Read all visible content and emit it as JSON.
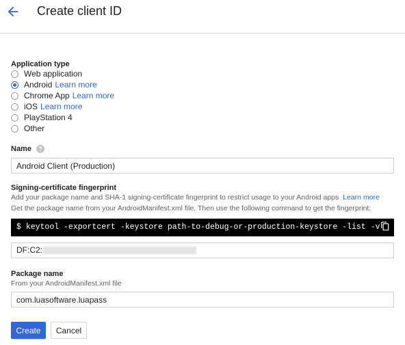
{
  "header": {
    "title": "Create client ID",
    "back_icon": "arrow-back-icon"
  },
  "app_type": {
    "label": "Application type",
    "options": [
      {
        "label": "Web application",
        "link": "",
        "checked": false
      },
      {
        "label": "Android",
        "link": "Learn more",
        "checked": true
      },
      {
        "label": "Chrome App",
        "link": "Learn more",
        "checked": false
      },
      {
        "label": "iOS",
        "link": "Learn more",
        "checked": false
      },
      {
        "label": "PlayStation 4",
        "link": "",
        "checked": false
      },
      {
        "label": "Other",
        "link": "",
        "checked": false
      }
    ]
  },
  "name": {
    "label": "Name",
    "help_icon": "help-icon",
    "value": "Android Client (Production)"
  },
  "fingerprint": {
    "label": "Signing-certificate fingerprint",
    "desc1": "Add your package name and SHA-1 signing-certificate fingerprint to restrict usage to your Android apps",
    "desc1_link": "Learn more",
    "desc2": "Get the package name from your AndroidManifest.xml file. Then use the following command to get the fingerprint:",
    "command_prompt": "$",
    "command": "keytool -exportcert -keystore path-to-debug-or-production-keystore -list -v",
    "copy_icon": "copy-icon",
    "value_prefix": "DF:C2:"
  },
  "package": {
    "label": "Package name",
    "desc": "From your AndroidManifest.xml file",
    "value": "com.luasoftware.luapass"
  },
  "buttons": {
    "create": "Create",
    "cancel": "Cancel"
  },
  "colors": {
    "accent": "#3367d6",
    "command_bg": "#000000"
  }
}
